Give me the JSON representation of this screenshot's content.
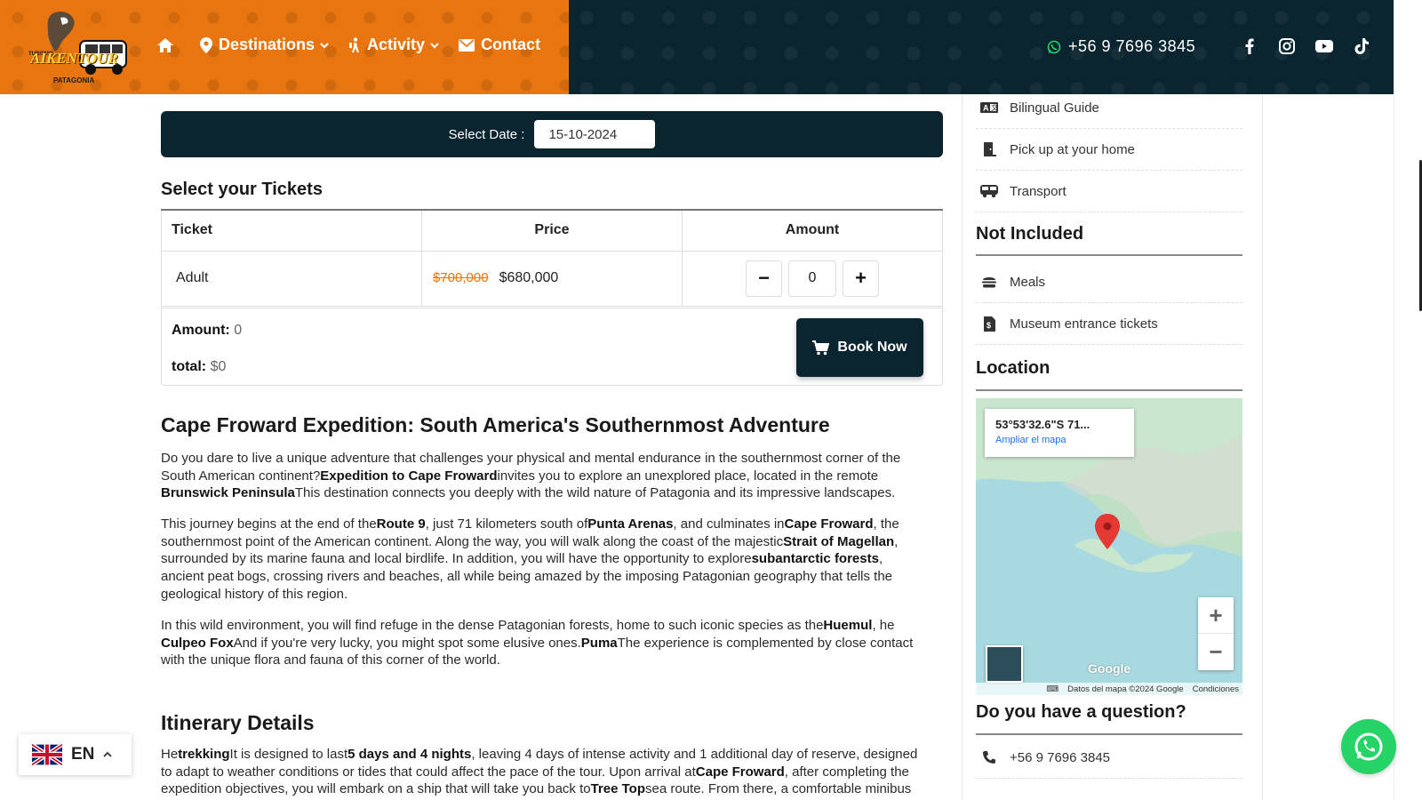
{
  "header": {
    "logo": {
      "top_text": "TURISMO",
      "main_text": "AIKENTOUR",
      "sub_text": "PATAGONIA"
    },
    "nav": [
      {
        "label": ""
      },
      {
        "label": "Destinations"
      },
      {
        "label": "Activity"
      },
      {
        "label": "Contact"
      }
    ],
    "phone": "+56 9 7696 3845",
    "socials": [
      "facebook-icon",
      "instagram-icon",
      "youtube-icon",
      "tiktok-icon"
    ],
    "colors": {
      "orange": "#e8750f",
      "dark": "#0b2530"
    }
  },
  "booking": {
    "date_label": "Select Date :",
    "date_value": "15-10-2024",
    "tickets_title": "Select your Tickets",
    "columns": [
      "Ticket",
      "Price",
      "Amount"
    ],
    "rows": [
      {
        "ticket": "Adult",
        "old_price": "$700,000",
        "price": "$680,000",
        "amount": "0"
      }
    ],
    "minus": "−",
    "plus": "+",
    "amount_label": "Amount:",
    "amount_value": "0",
    "total_label": "total:",
    "total_value": "$0",
    "book_now": "Book Now"
  },
  "article": {
    "title": "Cape Froward Expedition: South America's Southernmost Adventure",
    "p1": [
      {
        "t": "Do you dare to live a unique adventure that challenges your physical and mental endurance in the southernmost corner of the South American continent?"
      },
      {
        "b": "Expedition to Cape Froward"
      },
      {
        "t": "invites you to explore an unexplored place, located in the remote "
      },
      {
        "b": "Brunswick Peninsula"
      },
      {
        "t": "This destination connects you deeply with the wild nature of Patagonia and its impressive landscapes."
      }
    ],
    "p2": [
      {
        "t": "This journey begins at the end of the"
      },
      {
        "b": "Route 9"
      },
      {
        "t": ", just 71 kilometers south of"
      },
      {
        "b": "Punta Arenas"
      },
      {
        "t": ", and culminates in"
      },
      {
        "b": "Cape Froward"
      },
      {
        "t": ", the southernmost point of the American continent. Along the way, you will walk along the coast of the majestic"
      },
      {
        "b": "Strait of Magellan"
      },
      {
        "t": ", surrounded by its marine fauna and local birdlife. In addition, you will have the opportunity to explore"
      },
      {
        "b": "subantarctic forests"
      },
      {
        "t": ", ancient peat bogs, crossing rivers and beaches, all while being amazed by the imposing Patagonian geography that tells the geological history of this region."
      }
    ],
    "p3": [
      {
        "t": "In this wild environment, you will find refuge in the dense Patagonian forests, home to such iconic species as the"
      },
      {
        "b": "Huemul"
      },
      {
        "t": ", he "
      },
      {
        "b": "Culpeo Fox"
      },
      {
        "t": "And if you're very lucky, you might spot some elusive ones."
      },
      {
        "b": "Puma"
      },
      {
        "t": "The experience is complemented by close contact with the unique flora and fauna of this corner of the world."
      }
    ],
    "itinerary_title": "Itinerary Details",
    "p4": [
      {
        "t": "He"
      },
      {
        "b": "trekking"
      },
      {
        "t": "It is designed to last"
      },
      {
        "b": "5 days and 4 nights"
      },
      {
        "t": ", leaving 4 days of intense activity and 1 additional day of reserve, designed to adapt to weather conditions or tides that could affect the pace of the tour. Upon arrival at"
      },
      {
        "b": "Cape Froward"
      },
      {
        "t": ", after completing the expedition objectives, you will embark on a ship that will take you back to"
      },
      {
        "b": "Tree Top"
      },
      {
        "t": "sea route. From there, a comfortable minibus"
      }
    ]
  },
  "sidebar": {
    "included": [
      {
        "label": "Bilingual Guide",
        "icon": "translate-icon"
      },
      {
        "label": "Pick up at your home",
        "icon": "door-icon"
      },
      {
        "label": "Transport",
        "icon": "bus-icon"
      }
    ],
    "not_included_title": "Not Included",
    "not_included": [
      {
        "label": "Meals",
        "icon": "burger-icon"
      },
      {
        "label": "Museum entrance tickets",
        "icon": "ticket-file-icon"
      }
    ],
    "location_title": "Location",
    "map": {
      "coords": "53°53'32.6\"S 71...",
      "link": "Ampliar el mapa",
      "zoom_in": "+",
      "zoom_out": "−",
      "brand": "Google",
      "footer_data": "Datos del mapa ©2024 Google",
      "footer_terms": "Condiciones"
    },
    "question_title": "Do you have a question?",
    "question_phone": "+56 9 7696 3845"
  },
  "floating": {
    "lang": "EN"
  }
}
